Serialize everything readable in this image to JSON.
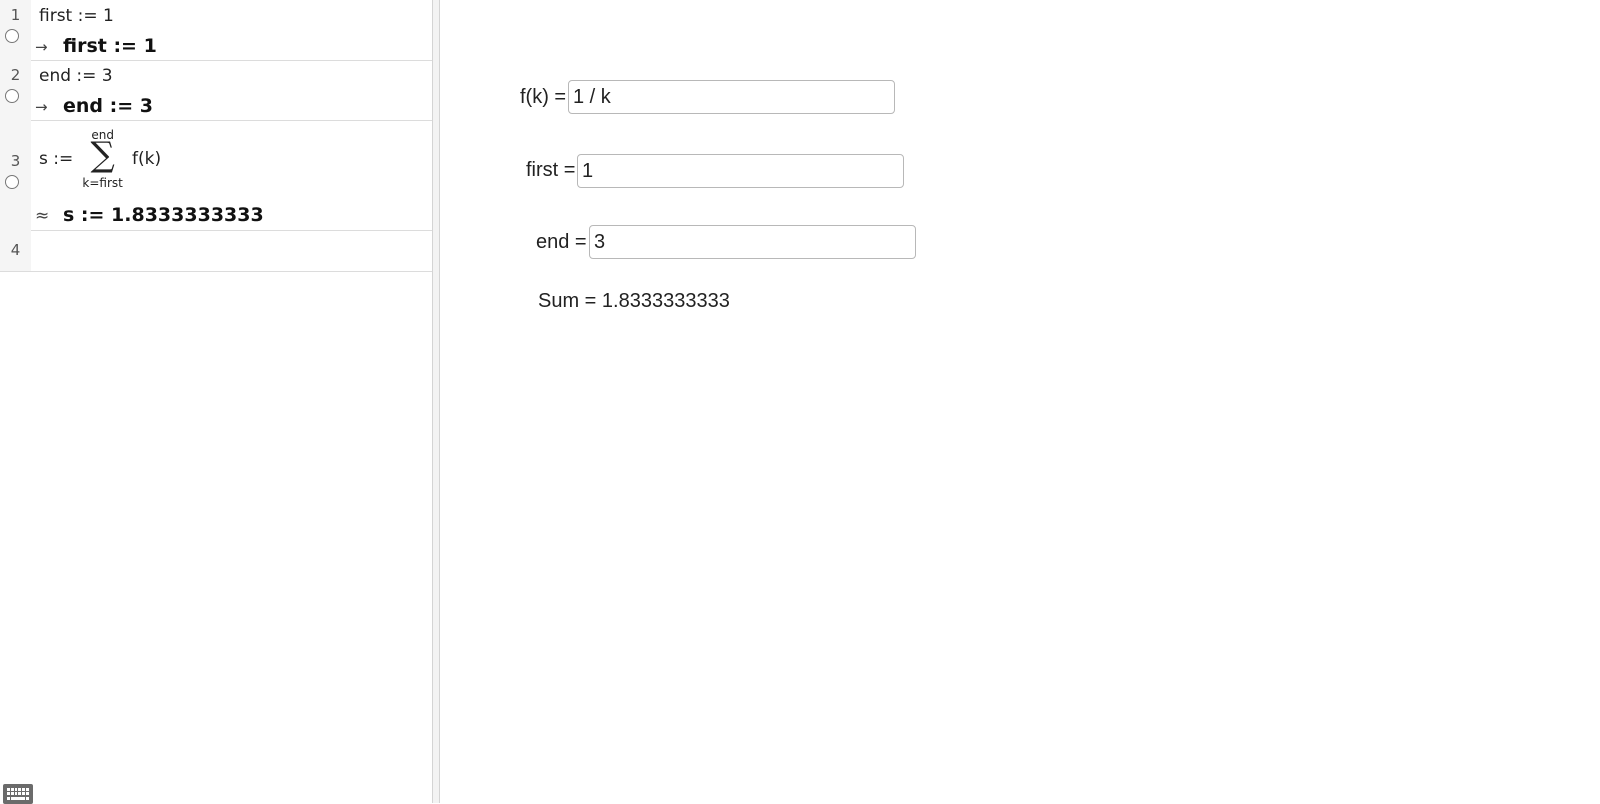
{
  "cas": {
    "rows": [
      {
        "number": "1",
        "input": "first := 1",
        "output_symbol": "→",
        "output": "first  :=  1"
      },
      {
        "number": "2",
        "input": "end := 3",
        "output_symbol": "→",
        "output": "end  :=  3"
      },
      {
        "number": "3",
        "input_lhs": "s :=",
        "sum_upper": "end",
        "sum_sigma": "∑",
        "sum_lower": "k=first",
        "sum_term": "f(k)",
        "output_symbol": "≈",
        "output": "s  :=  1.8333333333"
      },
      {
        "number": "4"
      }
    ]
  },
  "graphics": {
    "fk": {
      "label": "f(k) =",
      "value": "1 / k"
    },
    "first": {
      "label": "first =",
      "value": "1"
    },
    "end": {
      "label": "end =",
      "value": "3"
    },
    "sum_text": "Sum = 1.8333333333"
  },
  "icons": {
    "keyboard": "keyboard-icon",
    "toggle": "visibility-toggle-icon"
  }
}
